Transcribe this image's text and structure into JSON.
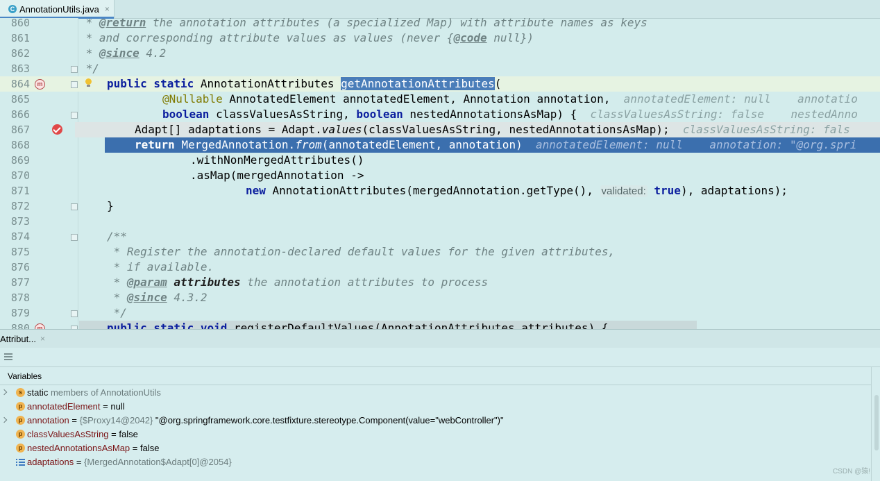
{
  "tab": {
    "icon_letter": "C",
    "filename": "AnnotationUtils.java",
    "close": "×"
  },
  "code_lines": [
    {
      "num": "860"
    },
    {
      "num": "861"
    },
    {
      "num": "862"
    },
    {
      "num": "863"
    },
    {
      "num": "864"
    },
    {
      "num": "865"
    },
    {
      "num": "866"
    },
    {
      "num": "867"
    },
    {
      "num": "868"
    },
    {
      "num": "869"
    },
    {
      "num": "870"
    },
    {
      "num": "871"
    },
    {
      "num": "872"
    },
    {
      "num": "873"
    },
    {
      "num": "874"
    },
    {
      "num": "875"
    },
    {
      "num": "876"
    },
    {
      "num": "877"
    },
    {
      "num": "878"
    },
    {
      "num": "879"
    },
    {
      "num": "880"
    }
  ],
  "code": {
    "l860": {
      "a": " * ",
      "tag": "@return",
      "b": " the annotation attributes (a specialized Map) with attribute names as keys"
    },
    "l861": " * and corresponding attribute values as values (never {",
    "l861_tag": "@code",
    "l861_end": " null})",
    "l862_a": " * ",
    "l862_tag": "@since",
    "l862_b": " 4.2",
    "l863": " */",
    "l864_kw": "public static",
    "l864_type": " AnnotationAttributes ",
    "l864_method": "getAnnotationAttributes",
    "l864_end": "(",
    "l865_ann": "@Nullable",
    "l865_body": " AnnotatedElement annotatedElement, Annotation annotation,",
    "l865_inlay": "annotatedElement: null    annotatio",
    "l866_kw1": "boolean",
    "l866_mid": " classValuesAsString, ",
    "l866_kw2": "boolean",
    "l866_end": " nestedAnnotationsAsMap) {",
    "l866_inlay": "classValuesAsString: false    nestedAnno",
    "l867_a": "Adapt[] adaptations = Adapt.",
    "l867_it": "values",
    "l867_b": "(classValuesAsString, nestedAnnotationsAsMap);",
    "l867_inlay": "classValuesAsString: fals",
    "l868_kw": "return",
    "l868_a": " MergedAnnotation.",
    "l868_it": "from",
    "l868_b": "(annotatedElement, annotation)",
    "l868_inlay": "annotatedElement: null    annotation: \"@org.spri",
    "l869": ".withNonMergedAttributes()",
    "l870": ".asMap(mergedAnnotation ->",
    "l871_kw": "new",
    "l871_a": " AnnotationAttributes(mergedAnnotation.getType(), ",
    "l871_hint": "validated:",
    "l871_kw2": "true",
    "l871_b": "), adaptations);",
    "l872": "}",
    "l874": "/**",
    "l875": " * Register the annotation-declared default values for the given attributes,",
    "l876": " * if available.",
    "l877_a": " * ",
    "l877_tag": "@param",
    "l877_bold": "attributes",
    "l877_b": " the annotation attributes to process",
    "l878_a": " * ",
    "l878_tag": "@since",
    "l878_b": " 4.3.2",
    "l879": " */",
    "l880_kw": "public static void",
    "l880_b": " registerDefaultValues(AnnotationAttributes attributes) {"
  },
  "gutter": {
    "method_marker": "m"
  },
  "debug": {
    "tab_label": "Attribut...",
    "tab_close": "×",
    "variables_header": "Variables",
    "rows": [
      {
        "icon": "s",
        "pre": "static",
        "name": "",
        "grey": " members of AnnotationUtils",
        "value": ""
      },
      {
        "icon": "p",
        "name": "annotatedElement",
        "eq": " = ",
        "grey": "",
        "value": "null"
      },
      {
        "icon": "p",
        "name": "annotation",
        "eq": " = ",
        "grey": "{$Proxy14@2042} ",
        "value": "\"@org.springframework.core.testfixture.stereotype.Component(value=\"webController\")\""
      },
      {
        "icon": "p",
        "name": "classValuesAsString",
        "eq": " = ",
        "grey": "",
        "value": "false"
      },
      {
        "icon": "p",
        "name": "nestedAnnotationsAsMap",
        "eq": " = ",
        "grey": "",
        "value": "false"
      },
      {
        "icon": "arr",
        "name": "adaptations",
        "eq": " = ",
        "grey": "{MergedAnnotation$Adapt[0]@2054}",
        "value": ""
      }
    ]
  },
  "watermark": "CSDN @猿!"
}
